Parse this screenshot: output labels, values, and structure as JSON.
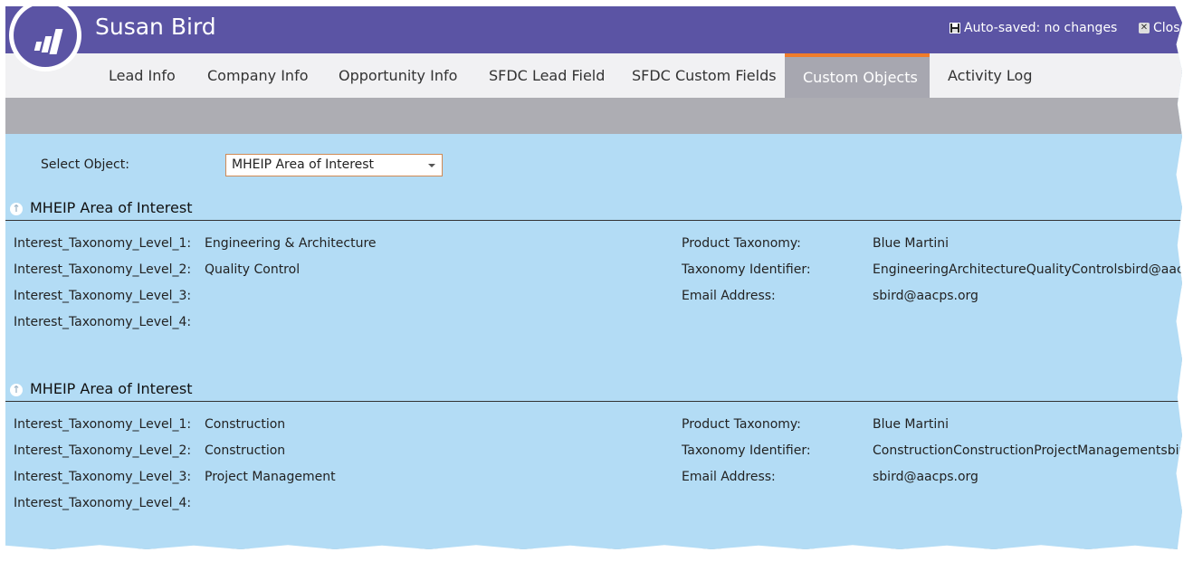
{
  "header": {
    "title": "Susan Bird",
    "autosave_label": "Auto-saved: no changes",
    "close_label": "Close"
  },
  "tabs": [
    {
      "label": "Lead Info",
      "active": false
    },
    {
      "label": "Company Info",
      "active": false
    },
    {
      "label": "Opportunity Info",
      "active": false
    },
    {
      "label": "SFDC Lead Field",
      "active": false
    },
    {
      "label": "SFDC Custom Fields",
      "active": false
    },
    {
      "label": "Custom Objects",
      "active": true
    },
    {
      "label": "Activity Log",
      "active": false
    }
  ],
  "colors": {
    "header": "#5b54a4",
    "active_tab_accent": "#f07c2a",
    "content_bg": "#b3dcf5"
  },
  "select": {
    "label": "Select Object:",
    "value": "MHEIP Area of Interest"
  },
  "sections": [
    {
      "title": "MHEIP Area of Interest",
      "left_fields": [
        {
          "label": "Interest_Taxonomy_Level_1:",
          "value": "Engineering & Architecture"
        },
        {
          "label": "Interest_Taxonomy_Level_2:",
          "value": "Quality Control"
        },
        {
          "label": "Interest_Taxonomy_Level_3:",
          "value": ""
        },
        {
          "label": "Interest_Taxonomy_Level_4:",
          "value": ""
        }
      ],
      "right_fields": [
        {
          "label": "Product Taxonomy:",
          "value": "Blue Martini"
        },
        {
          "label": "Taxonomy Identifier:",
          "value": "EngineeringArchitectureQualityControlsbird@aacp"
        },
        {
          "label": "Email Address:",
          "value": "sbird@aacps.org"
        }
      ]
    },
    {
      "title": "MHEIP Area of Interest",
      "left_fields": [
        {
          "label": "Interest_Taxonomy_Level_1:",
          "value": "Construction"
        },
        {
          "label": "Interest_Taxonomy_Level_2:",
          "value": "Construction"
        },
        {
          "label": "Interest_Taxonomy_Level_3:",
          "value": "Project Management"
        },
        {
          "label": "Interest_Taxonomy_Level_4:",
          "value": ""
        }
      ],
      "right_fields": [
        {
          "label": "Product Taxonomy:",
          "value": "Blue Martini"
        },
        {
          "label": "Taxonomy Identifier:",
          "value": "ConstructionConstructionProjectManagementsbird"
        },
        {
          "label": "Email Address:",
          "value": "sbird@aacps.org"
        }
      ]
    }
  ]
}
